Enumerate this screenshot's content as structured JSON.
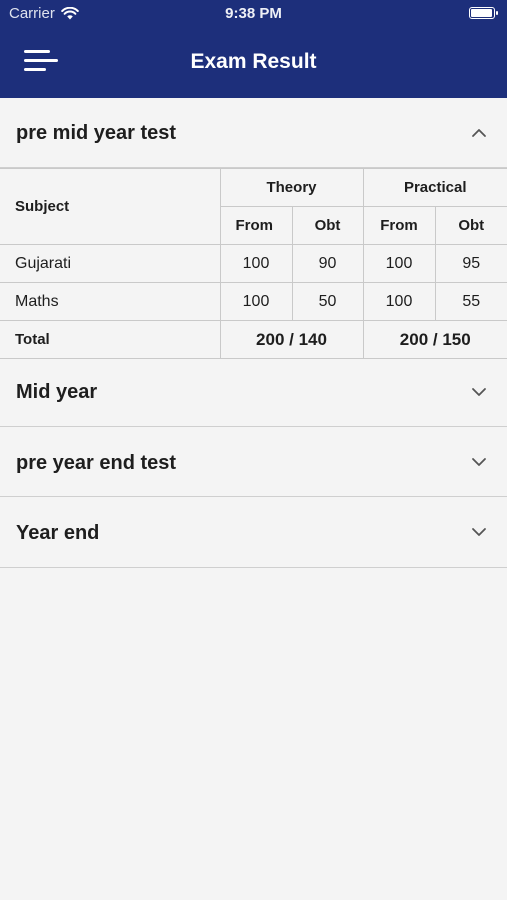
{
  "status_bar": {
    "carrier": "Carrier",
    "time": "9:38 PM",
    "battery_level": 1.0
  },
  "header": {
    "title": "Exam Result",
    "menu_icon": "hamburger-menu-icon"
  },
  "sections": [
    {
      "title": "pre mid year test",
      "expanded": true,
      "icon": "chevron-up-icon"
    },
    {
      "title": "Mid year",
      "expanded": false,
      "icon": "chevron-down-icon"
    },
    {
      "title": "pre year end test",
      "expanded": false,
      "icon": "chevron-down-icon"
    },
    {
      "title": "Year end",
      "expanded": false,
      "icon": "chevron-down-icon"
    }
  ],
  "result_table": {
    "subject_header": "Subject",
    "theory_header": "Theory",
    "practical_header": "Practical",
    "from_label": "From",
    "obt_label": "Obt",
    "rows": [
      {
        "subject": "Gujarati",
        "theory_from": "100",
        "theory_obt": "90",
        "practical_from": "100",
        "practical_obt": "95"
      },
      {
        "subject": "Maths",
        "theory_from": "100",
        "theory_obt": "50",
        "practical_from": "100",
        "practical_obt": "55"
      }
    ],
    "total_label": "Total",
    "theory_total": "200 / 140",
    "practical_total": "200 / 150"
  },
  "colors": {
    "header_bg": "#1d2f7b",
    "page_bg": "#f4f4f4",
    "divider": "#cfcfcf"
  }
}
